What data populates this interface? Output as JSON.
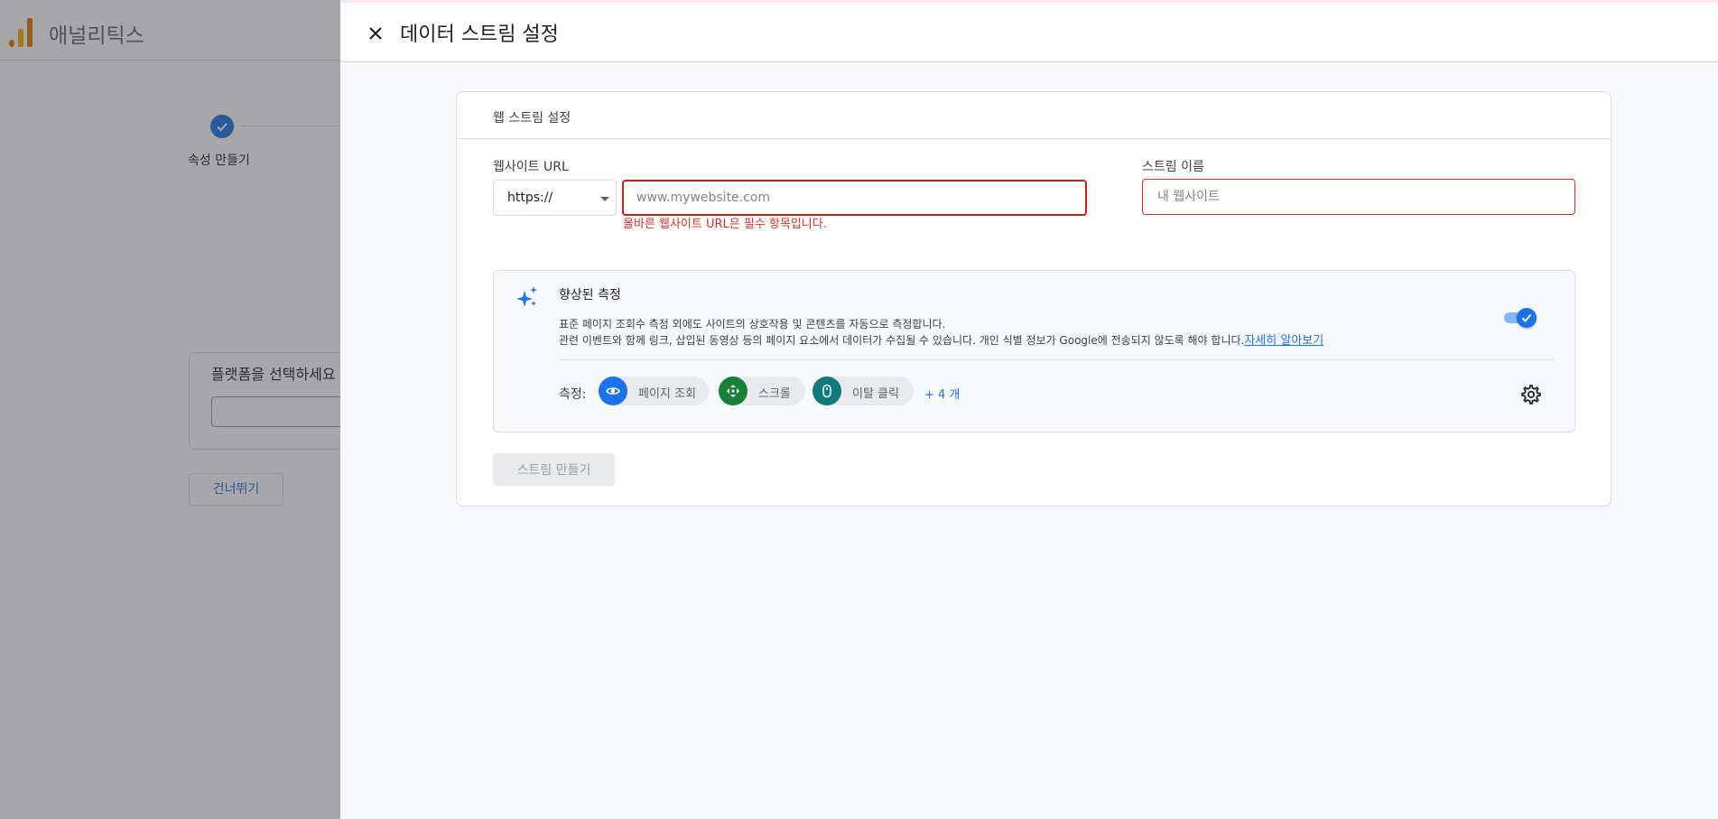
{
  "app": {
    "title": "애널리틱스"
  },
  "background": {
    "step_label": "속성 만들기",
    "platform_card_title": "플랫폼을 선택하세요",
    "skip_button": "건너뛰기"
  },
  "panel": {
    "title": "데이터 스트림 설정",
    "close_icon": "close-icon"
  },
  "card": {
    "title": "웹 스트림 설정",
    "url_label": "웹사이트 URL",
    "protocol": "https://",
    "url_placeholder": "www.mywebsite.com",
    "url_error": "올바른 웹사이트 URL은 필수 항목입니다.",
    "name_label": "스트림 이름",
    "name_placeholder": "내 웹사이트"
  },
  "enhanced": {
    "title": "향상된 측정",
    "desc_line1": "표준 페이지 조회수 측정 외에도 사이트의 상호작용 및 콘텐츠를 자동으로 측정합니다.",
    "desc_line2": "관련 이벤트와 함께 링크, 삽입된 동영상 등의 페이지 요소에서 데이터가 수집될 수 있습니다. 개인 식별 정보가 Google에 전송되지 않도록 해야 합니다.",
    "learn_more": "자세히 알아보기",
    "toggle_on": true,
    "measure_label": "측정:",
    "chips": [
      {
        "label": "페이지 조회",
        "icon": "eye-icon",
        "color": "#1a73e8"
      },
      {
        "label": "스크롤",
        "icon": "scroll-icon",
        "color": "#188038"
      },
      {
        "label": "이탈 클릭",
        "icon": "mouse-icon",
        "color": "#12797d"
      }
    ],
    "more": "+ 4 개",
    "settings_icon": "gear-icon"
  },
  "create_button": "스트림 만들기",
  "colors": {
    "accent": "#1a73e8",
    "error": "#d93025"
  }
}
